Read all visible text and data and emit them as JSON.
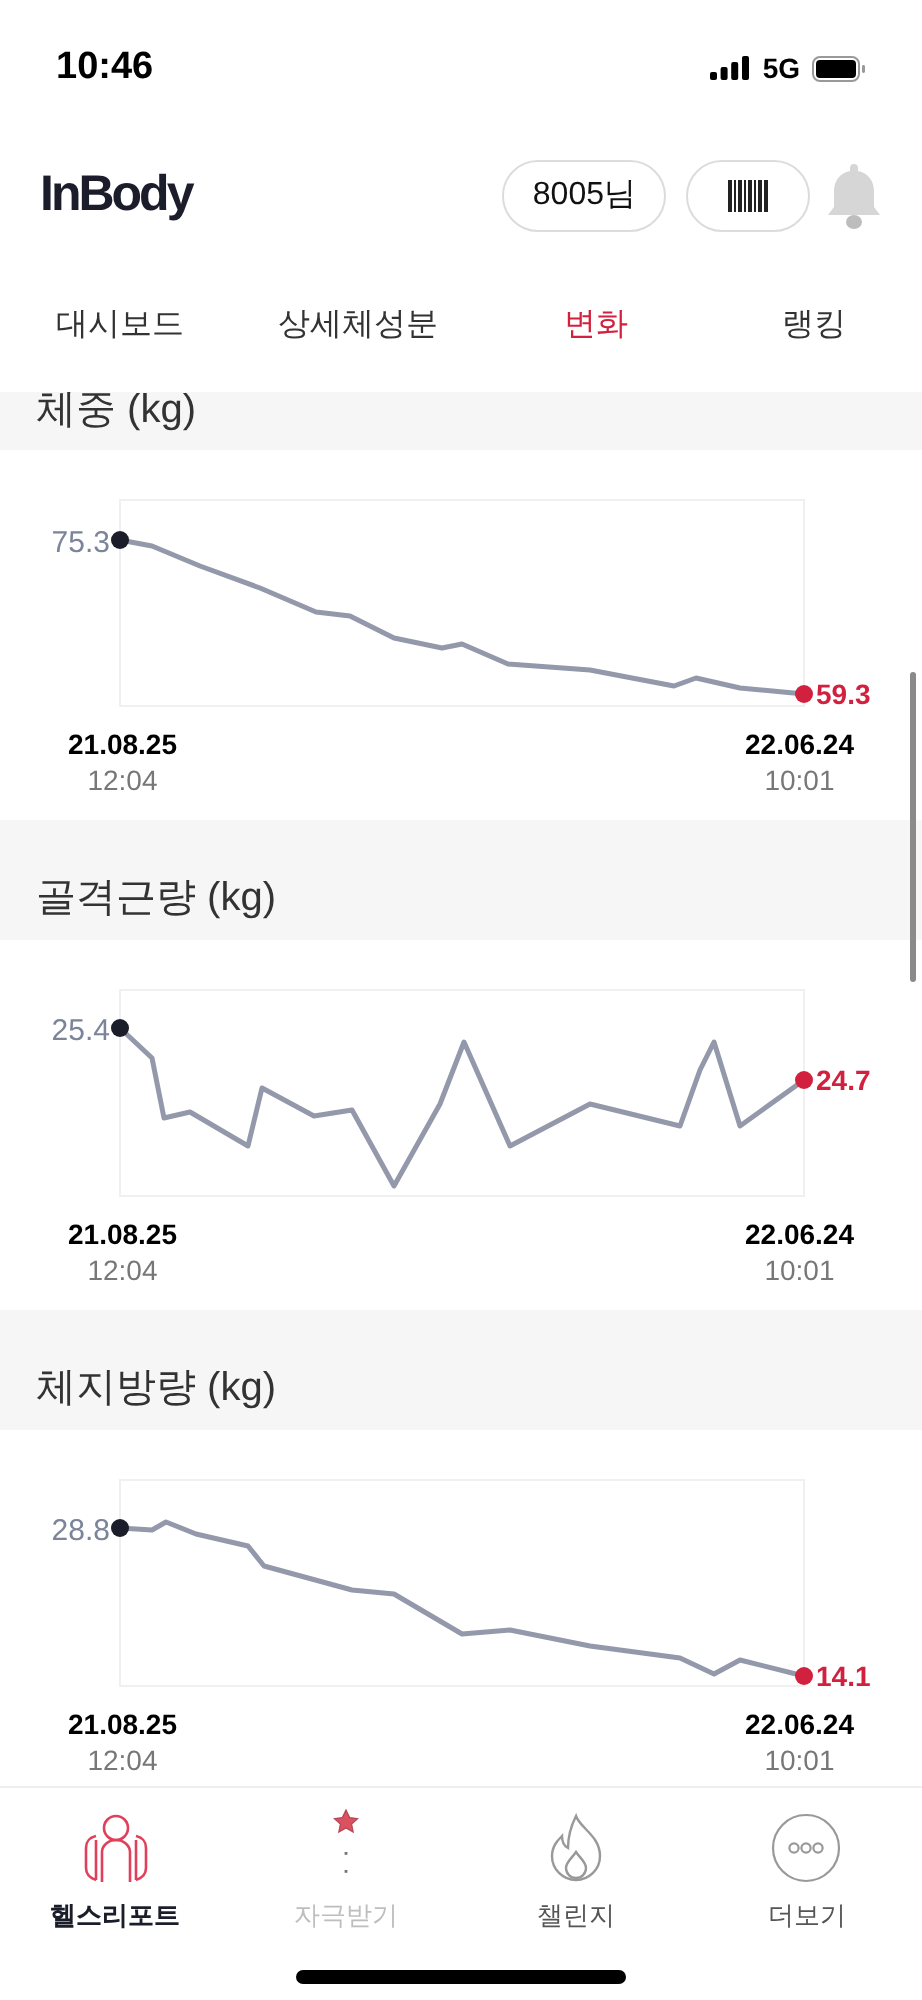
{
  "status_bar": {
    "time": "10:46",
    "network": "5G"
  },
  "header": {
    "logo": "InBody",
    "user": "8005님"
  },
  "tabs": [
    {
      "label": "대시보드",
      "selected": false
    },
    {
      "label": "상세체성분",
      "selected": false
    },
    {
      "label": "변화",
      "selected": true
    },
    {
      "label": "랭킹",
      "selected": false
    }
  ],
  "sections": [
    {
      "title": "체중 (kg)",
      "start": {
        "value": "75.3",
        "date": "21.08.25",
        "time": "12:04"
      },
      "end": {
        "value": "59.3",
        "date": "22.06.24",
        "time": "10:01"
      }
    },
    {
      "title": "골격근량 (kg)",
      "start": {
        "value": "25.4",
        "date": "21.08.25",
        "time": "12:04"
      },
      "end": {
        "value": "24.7",
        "date": "22.06.24",
        "time": "10:01"
      }
    },
    {
      "title": "체지방량 (kg)",
      "start": {
        "value": "28.8",
        "date": "21.08.25",
        "time": "12:04"
      },
      "end": {
        "value": "14.1",
        "date": "22.06.24",
        "time": "10:01"
      }
    }
  ],
  "bottom_nav": [
    {
      "label": "헬스리포트",
      "selected": true,
      "disabled": false
    },
    {
      "label": "자극받기",
      "selected": false,
      "disabled": true
    },
    {
      "label": "챌린지",
      "selected": false,
      "disabled": false
    },
    {
      "label": "더보기",
      "selected": false,
      "disabled": false
    }
  ]
}
